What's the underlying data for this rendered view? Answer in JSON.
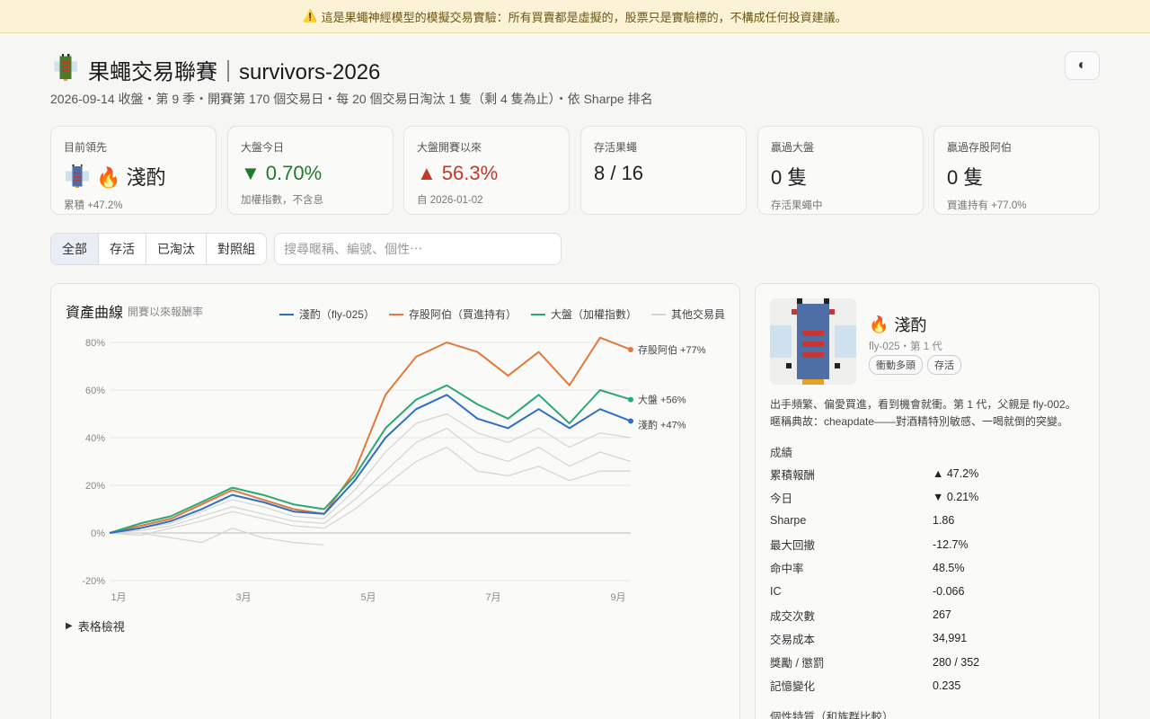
{
  "banner": {
    "icon": "⚠️",
    "text": "這是果蠅神經模型的模擬交易實驗：所有買賣都是虛擬的，股票只是實驗標的，不構成任何投資建議。"
  },
  "header": {
    "icon": "🪲",
    "title": "果蠅交易聯賽｜survivors-2026",
    "subtitle": "2026-09-14 收盤・第 9 季・開賽第 170 個交易日・每 20 個交易日淘汰 1 隻（剩 4 隻為止）・依 Sharpe 排名",
    "theme_toggle_icon": "◐"
  },
  "cards": [
    {
      "label": "目前領先",
      "value": "🔥 淺酌",
      "sub": "累積 +47.2%"
    },
    {
      "label": "大盤今日",
      "arrow": "▼",
      "value": "0.70%",
      "sub": "加權指數，不含息",
      "color": "green"
    },
    {
      "label": "大盤開賽以來",
      "arrow": "▲",
      "value": "56.3%",
      "sub": "自 2026-01-02",
      "color": "red"
    },
    {
      "label": "存活果蠅",
      "value": "8 / 16",
      "sub": ""
    },
    {
      "label": "贏過大盤",
      "value": "0 隻",
      "sub": "存活果蠅中"
    },
    {
      "label": "贏過存股阿伯",
      "value": "0 隻",
      "sub": "買進持有 +77.0%"
    }
  ],
  "tabs": [
    "全部",
    "存活",
    "已淘汰",
    "對照組"
  ],
  "search": {
    "placeholder": "搜尋暱稱、編號、個性⋯",
    "value": ""
  },
  "chart": {
    "title": "資產曲線",
    "subtitle": "開賽以來報酬率",
    "legend": [
      {
        "name": "淺酌（fly-025）",
        "color": "#2e6fc4"
      },
      {
        "name": "存股阿伯（買進持有）",
        "color": "#e07a3a"
      },
      {
        "name": "大盤（加權指數）",
        "color": "#2aa876"
      },
      {
        "name": "其他交易員",
        "color": "#d4d4d0"
      }
    ],
    "end_labels": [
      "存股阿伯 +77%",
      "大盤 +56%",
      "淺酌 +47%"
    ],
    "table_toggle": "表格檢視"
  },
  "chart_data": {
    "type": "line",
    "x": [
      "2026-01-02",
      "2026-01-15",
      "2026-02-01",
      "2026-02-15",
      "2026-03-01",
      "2026-03-15",
      "2026-04-01",
      "2026-04-15",
      "2026-05-01",
      "2026-05-15",
      "2026-06-01",
      "2026-06-15",
      "2026-07-01",
      "2026-07-15",
      "2026-08-01",
      "2026-08-15",
      "2026-09-01",
      "2026-09-14"
    ],
    "x_ticks": [
      "1月",
      "3月",
      "5月",
      "7月",
      "9月"
    ],
    "y_ticks": [
      "80%",
      "60%",
      "40%",
      "20%",
      "0%",
      "-20%"
    ],
    "ylim": [
      -20,
      80
    ],
    "series": [
      {
        "name": "存股阿伯（買進持有）",
        "color": "#e07a3a",
        "values": [
          0,
          3,
          6,
          12,
          18,
          14,
          10,
          8,
          26,
          58,
          74,
          80,
          76,
          66,
          76,
          62,
          82,
          77
        ]
      },
      {
        "name": "大盤（加權指數）",
        "color": "#2aa876",
        "values": [
          0,
          4,
          7,
          13,
          19,
          16,
          12,
          10,
          24,
          44,
          56,
          62,
          54,
          48,
          58,
          46,
          60,
          56
        ]
      },
      {
        "name": "淺酌（fly-025）",
        "color": "#2e6fc4",
        "values": [
          0,
          2,
          5,
          10,
          16,
          13,
          9,
          8,
          22,
          40,
          52,
          58,
          48,
          44,
          52,
          44,
          52,
          47
        ]
      },
      {
        "name": "其他交易員",
        "color": "#d4d4d0",
        "values": [
          0,
          2,
          4,
          9,
          14,
          11,
          7,
          6,
          18,
          34,
          46,
          50,
          42,
          38,
          44,
          36,
          42,
          40
        ]
      },
      {
        "name": "其他交易員",
        "color": "#d4d4d0",
        "values": [
          0,
          1,
          3,
          7,
          11,
          8,
          5,
          4,
          14,
          26,
          38,
          44,
          34,
          30,
          36,
          28,
          34,
          30
        ]
      },
      {
        "name": "其他交易員",
        "color": "#d4d4d0",
        "values": [
          0,
          -1,
          2,
          5,
          9,
          6,
          3,
          2,
          10,
          20,
          30,
          36,
          26,
          24,
          28,
          22,
          26,
          26
        ]
      },
      {
        "name": "其他交易員",
        "color": "#d4d4d0",
        "values": [
          0,
          0,
          -2,
          -4,
          2,
          -2,
          -4,
          -5
        ]
      }
    ]
  },
  "detail": {
    "avatar_icon": "fly-pixel-avatar",
    "name_icon": "🔥",
    "name": "淺酌",
    "meta": "fly-025・第 1 代",
    "badges": [
      "衝動多頭",
      "存活"
    ],
    "description": "出手頻繁、偏愛買進，看到機會就衝。第 1 代，父親是 fly-002。暱稱典故：cheapdate——對酒精特別敏感、一喝就倒的突變。",
    "stats_title": "成績",
    "stats": [
      {
        "k": "累積報酬",
        "v": "▲ 47.2%"
      },
      {
        "k": "今日",
        "v": "▼ 0.21%"
      },
      {
        "k": "Sharpe",
        "v": "1.86"
      },
      {
        "k": "最大回撤",
        "v": "-12.7%"
      },
      {
        "k": "命中率",
        "v": "48.5%"
      },
      {
        "k": "IC",
        "v": "-0.066"
      },
      {
        "k": "成交次數",
        "v": "267"
      },
      {
        "k": "交易成本",
        "v": "34,991"
      },
      {
        "k": "獎勵 / 懲罰",
        "v": "280 / 352"
      },
      {
        "k": "記憶變化",
        "v": "0.235"
      }
    ],
    "traits_title": "個性特質（和族群比較）"
  }
}
